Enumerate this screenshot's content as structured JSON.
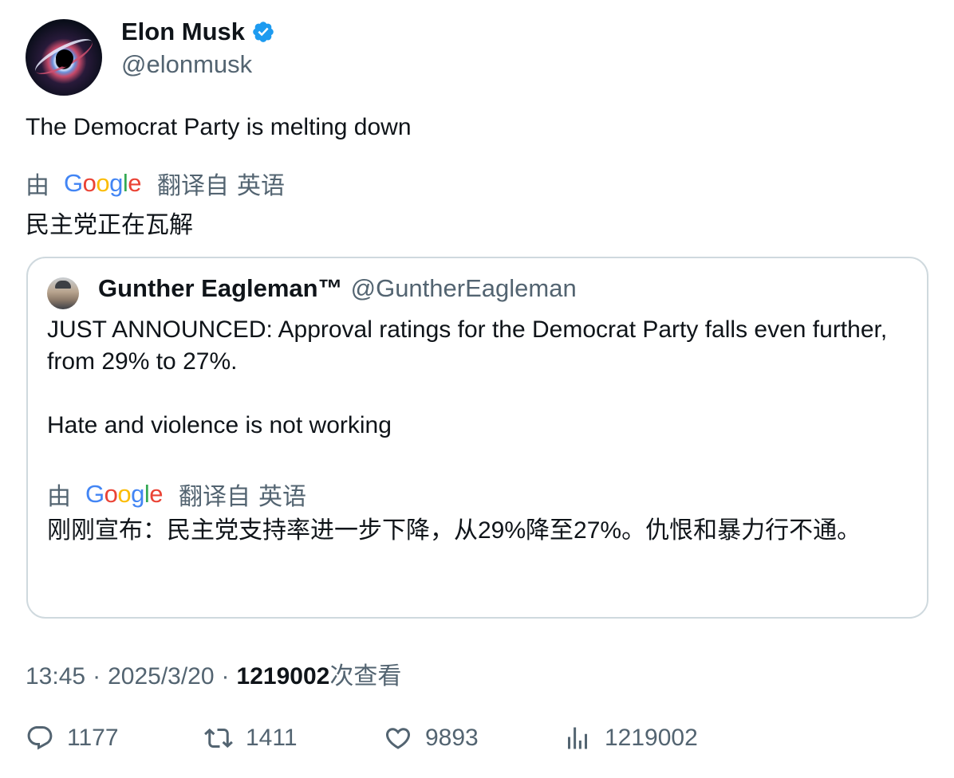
{
  "author": {
    "display_name": "Elon Musk",
    "handle": "@elonmusk",
    "verified_icon": "verified-badge-icon",
    "verified_color": "#1d9bf0"
  },
  "tweet": {
    "text": "The Democrat Party is melting down",
    "translation": {
      "by_label": "由",
      "provider": "Google",
      "from_label": "翻译自",
      "language": "英语",
      "text": "民主党正在瓦解"
    }
  },
  "quote": {
    "display_name": "Gunther Eagleman™",
    "handle": "@GuntherEagleman",
    "paragraphs": [
      "JUST ANNOUNCED: Approval ratings for the Democrat Party falls even further,  from 29% to 27%.",
      "Hate and violence is not working"
    ],
    "translation": {
      "by_label": "由",
      "provider": "Google",
      "from_label": "翻译自",
      "language": "英语",
      "text": "刚刚宣布：民主党支持率进一步下降，从29%降至27%。仇恨和暴力行不通。"
    }
  },
  "meta": {
    "time": "13:45",
    "separator": "·",
    "date": "2025/3/20",
    "views_count": "1219002",
    "views_label": "次查看"
  },
  "actions": {
    "reply_count": "1177",
    "retweet_count": "1411",
    "like_count": "9893",
    "views_count": "1219002"
  },
  "colors": {
    "text_primary": "#0f1419",
    "text_secondary": "#536471",
    "border": "#cfd9de",
    "google_blue": "#4285F4",
    "google_red": "#EA4335",
    "google_yellow": "#FBBC05",
    "google_green": "#34A853"
  }
}
